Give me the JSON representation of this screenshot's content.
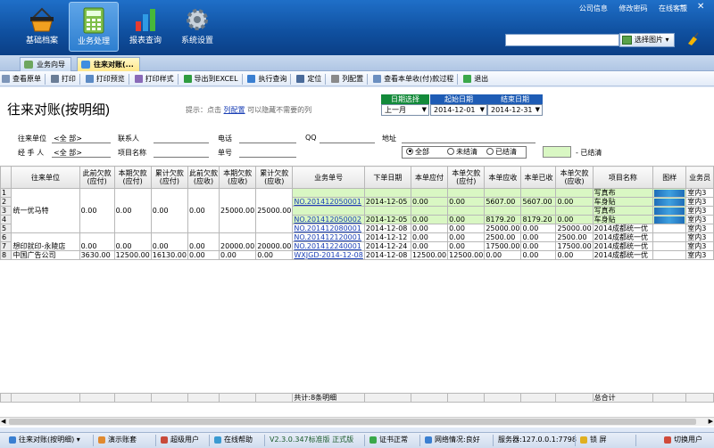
{
  "header": {
    "nav": [
      {
        "label": "基础档案",
        "icon": "basket-icon"
      },
      {
        "label": "业务处理",
        "icon": "calculator-icon"
      },
      {
        "label": "报表查询",
        "icon": "bar-chart-icon"
      },
      {
        "label": "系统设置",
        "icon": "gear-icon"
      }
    ],
    "links": [
      "公司信息",
      "修改密码",
      "在线客服"
    ],
    "search_value": "",
    "select_image_label": "选择图片"
  },
  "tabs": [
    "业务向导",
    "往来对账(..."
  ],
  "toolbar": [
    "查看原单",
    "打印",
    "打印预览",
    "打印样式",
    "导出到EXCEL",
    "执行查询",
    "定位",
    "列配置",
    "查看本单收(付)款过程",
    "退出"
  ],
  "page": {
    "title": "往来对账(按明细)",
    "hint_prefix": "提示：点击",
    "hint_link": "列配置",
    "hint_suffix": "可以隐藏不需要的列"
  },
  "dates": {
    "select_header": "日期选择",
    "select_value": "上一月",
    "start_header": "起始日期",
    "start_value": "2014-12-01",
    "end_header": "结束日期",
    "end_value": "2014-12-31"
  },
  "filters": {
    "unit_label": "往来单位",
    "unit_value": "<全 部>",
    "contact_label": "联系人",
    "phone_label": "电话",
    "qq_label": "QQ",
    "address_label": "地址",
    "handler_label": "经 手 人",
    "handler_value": "<全 部>",
    "project_label": "项目名称",
    "docno_label": "单号",
    "radio_all": "全部",
    "radio_unsettled": "未结清",
    "radio_settled": "已结清",
    "legend_text": "- 已结清"
  },
  "grid": {
    "headers": [
      "",
      "往来单位",
      "此前欠款(应付)",
      "本期欠款(应付)",
      "累计欠款(应付)",
      "此前欠款(应收)",
      "本期欠款(应收)",
      "累计欠款(应收)",
      "业务单号",
      "下单日期",
      "本单应付",
      "本单欠款(应付)",
      "本单应收",
      "本单已收",
      "本单欠款(应收)",
      "项目名称",
      "图样",
      "业务员"
    ],
    "rows": [
      {
        "n": "1",
        "unit": "",
        "c1": "",
        "c2": "",
        "c3": "",
        "c4": "",
        "c5": "",
        "c6": "",
        "doc": "",
        "date": "",
        "pay": "",
        "owepay": "",
        "rec": "",
        "got": "",
        "owerec": "",
        "proj": "写真布",
        "img": true,
        "staff": "室内3"
      },
      {
        "n": "2",
        "unit": "",
        "c1": "",
        "c2": "",
        "c3": "",
        "c4": "",
        "c5": "",
        "c6": "",
        "doc": "NO.201412050001",
        "date": "2014-12-05",
        "pay": "0.00",
        "owepay": "0.00",
        "rec": "5607.00",
        "got": "5607.00",
        "owerec": "0.00",
        "proj": "车身贴",
        "img": true,
        "staff": "室内3"
      },
      {
        "n": "3",
        "unit": "统一优马特",
        "c1": "0.00",
        "c2": "0.00",
        "c3": "0.00",
        "c4": "0.00",
        "c5": "25000.00",
        "c6": "25000.00",
        "doc": "",
        "date": "",
        "pay": "",
        "owepay": "",
        "rec": "",
        "got": "",
        "owerec": "",
        "proj": "写真布",
        "img": true,
        "staff": "室内3"
      },
      {
        "n": "4",
        "unit": "",
        "c1": "",
        "c2": "",
        "c3": "",
        "c4": "",
        "c5": "",
        "c6": "",
        "doc": "NO.201412050002",
        "date": "2014-12-05",
        "pay": "0.00",
        "owepay": "0.00",
        "rec": "8179.20",
        "got": "8179.20",
        "owerec": "0.00",
        "proj": "车身贴",
        "img": true,
        "staff": "室内3"
      },
      {
        "n": "5",
        "unit": "",
        "c1": "",
        "c2": "",
        "c3": "",
        "c4": "",
        "c5": "",
        "c6": "",
        "doc": "NO.201412080001",
        "date": "2014-12-08",
        "pay": "0.00",
        "owepay": "0.00",
        "rec": "25000.00",
        "got": "0.00",
        "owerec": "25000.00",
        "proj": "2014成都统一优",
        "img": false,
        "staff": "室内3"
      },
      {
        "n": "6",
        "unit": "",
        "c1": "",
        "c2": "",
        "c3": "",
        "c4": "",
        "c5": "",
        "c6": "",
        "doc": "NO.201412120001",
        "date": "2014-12-12",
        "pay": "0.00",
        "owepay": "0.00",
        "rec": "2500.00",
        "got": "0.00",
        "owerec": "2500.00",
        "proj": "2014成都统一优",
        "img": false,
        "staff": "室内3"
      },
      {
        "n": "7",
        "unit": "想印就印-永陵店",
        "c1": "0.00",
        "c2": "0.00",
        "c3": "0.00",
        "c4": "0.00",
        "c5": "20000.00",
        "c6": "20000.00",
        "doc": "NO.201412240001",
        "date": "2014-12-24",
        "pay": "0.00",
        "owepay": "0.00",
        "rec": "17500.00",
        "got": "0.00",
        "owerec": "17500.00",
        "proj": "2014成都统一优",
        "img": false,
        "staff": "室内3"
      },
      {
        "n": "8",
        "unit": "中国广告公司",
        "c1": "3630.00",
        "c2": "12500.00",
        "c3": "16130.00",
        "c4": "0.00",
        "c5": "0.00",
        "c6": "0.00",
        "doc": "WXJGD-2014-12-08",
        "date": "2014-12-08",
        "pay": "12500.00",
        "owepay": "12500.00",
        "rec": "0.00",
        "got": "0.00",
        "owerec": "0.00",
        "proj": "2014成都统一优",
        "img": false,
        "staff": "室内3"
      }
    ],
    "footer_count": "共计:8条明细",
    "footer_total": "总合计"
  },
  "statusbar": {
    "report": "往来对账(按明细)",
    "demo": "演示账套",
    "user": "超级用户",
    "help": "在线帮助",
    "version": "V2.3.0.347标准版 正式版",
    "cert": "证书正常",
    "network": "网络情况:良好",
    "server": "服务器:127.0.0.1:7798",
    "lock": "锁 屏",
    "switch_user": "切换用户"
  },
  "colors": {
    "header_bg": "#0f4f9e",
    "settled_green": "#d9f7c3",
    "link_blue": "#1a3fb5"
  }
}
